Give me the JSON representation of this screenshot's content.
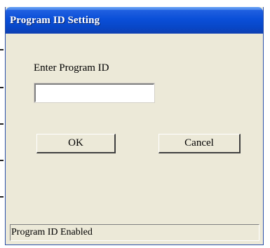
{
  "dialog": {
    "title": "Program ID Setting"
  },
  "form": {
    "prompt_label": "Enter Program ID",
    "program_id_value": "",
    "program_id_placeholder": ""
  },
  "buttons": {
    "ok_label": "OK",
    "cancel_label": "Cancel"
  },
  "status": {
    "text": "Program ID Enabled"
  },
  "colors": {
    "titlebar_blue": "#0a4fd8",
    "dialog_face": "#ece9d8",
    "title_text": "#ffffff"
  }
}
